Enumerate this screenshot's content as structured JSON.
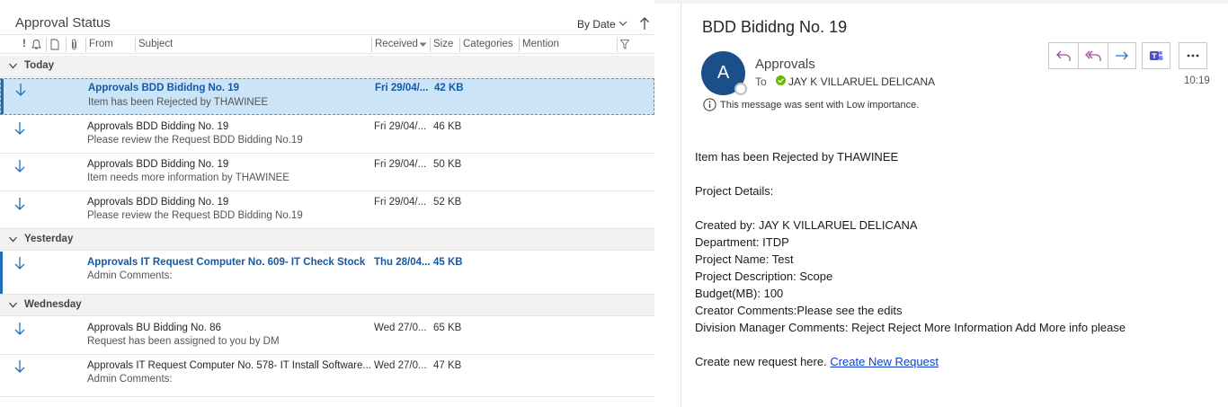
{
  "list": {
    "folder_title": "Approval Status",
    "sort_label": "By Date",
    "columns": {
      "importance": "!",
      "from": "From",
      "subject": "Subject",
      "received": "Received",
      "size": "Size",
      "categories": "Categories",
      "mention": "Mention"
    },
    "groups": [
      {
        "label": "Today",
        "messages": [
          {
            "sender": "Approvals",
            "subject": "BDD Bididng No. 19",
            "preview": "Item has been Rejected by THAWINEE",
            "date": "Fri 29/04/...",
            "size": "42 KB"
          },
          {
            "sender": "Approvals",
            "subject": "BDD Bidding No. 19",
            "preview": "Please review the Request BDD Bidding No.19",
            "date": "Fri 29/04/...",
            "size": "46 KB"
          },
          {
            "sender": "Approvals",
            "subject": "BDD Bidding No. 19",
            "preview": "Item needs more information by THAWINEE",
            "date": "Fri 29/04/...",
            "size": "50 KB"
          },
          {
            "sender": "Approvals",
            "subject": "BDD Bidding No. 19",
            "preview": "Please review the Request BDD Bidding No.19",
            "date": "Fri 29/04/...",
            "size": "52 KB"
          }
        ]
      },
      {
        "label": "Yesterday",
        "messages": [
          {
            "sender": "Approvals",
            "subject": "IT Request Computer No. 609- IT Check Stock",
            "preview": "Admin Comments:",
            "date": "Thu 28/04...",
            "size": "45 KB"
          }
        ]
      },
      {
        "label": "Wednesday",
        "messages": [
          {
            "sender": "Approvals",
            "subject": "BU Bidding No. 86",
            "preview": "Request has been assigned to you by DM",
            "date": "Wed 27/0...",
            "size": "65 KB"
          },
          {
            "sender": "Approvals",
            "subject": "IT Request Computer No. 578- IT Install Software...",
            "preview": "Admin Comments:",
            "date": "Wed 27/0...",
            "size": "47 KB"
          }
        ]
      }
    ]
  },
  "reading": {
    "subject": "BDD Bididng No. 19",
    "avatar_initial": "A",
    "sender": "Approvals",
    "to_label": "To",
    "to_name": "JAY K VILLARUEL DELICANA",
    "importance_note": "This message was sent with Low importance.",
    "time": "10:19",
    "body": {
      "line1": "Item has been Rejected by THAWINEE",
      "line2": "Project Details:",
      "line3": "Created by: JAY K VILLARUEL DELICANA",
      "line4": "Department: ITDP",
      "line5": "Project Name: Test",
      "line6": "Project Description: Scope",
      "line7": "Budget(MB): 100",
      "line8": "Creator Comments:Please see the edits",
      "line9": "Division Manager Comments: Reject Reject More Information Add More info please",
      "link_prefix": "Create new request here. ",
      "link_text": "Create New Request"
    }
  },
  "colors": {
    "accent": "#1f6fb5",
    "selected_bg": "#cce4f7",
    "unread_text": "#1459a3",
    "reply_purple": "#a64ca6",
    "forward_blue": "#2b76c5",
    "teams_purple": "#4b53bc",
    "presence_green": "#6bb700"
  },
  "icons": [
    "download-arrow-icon",
    "reply-icon",
    "reply-all-icon",
    "forward-icon",
    "teams-icon",
    "more-icon",
    "info-icon",
    "check-icon",
    "sort-arrow-icon",
    "chevron-down-icon",
    "filter-icon",
    "reminder-icon",
    "document-icon",
    "attachment-icon"
  ]
}
